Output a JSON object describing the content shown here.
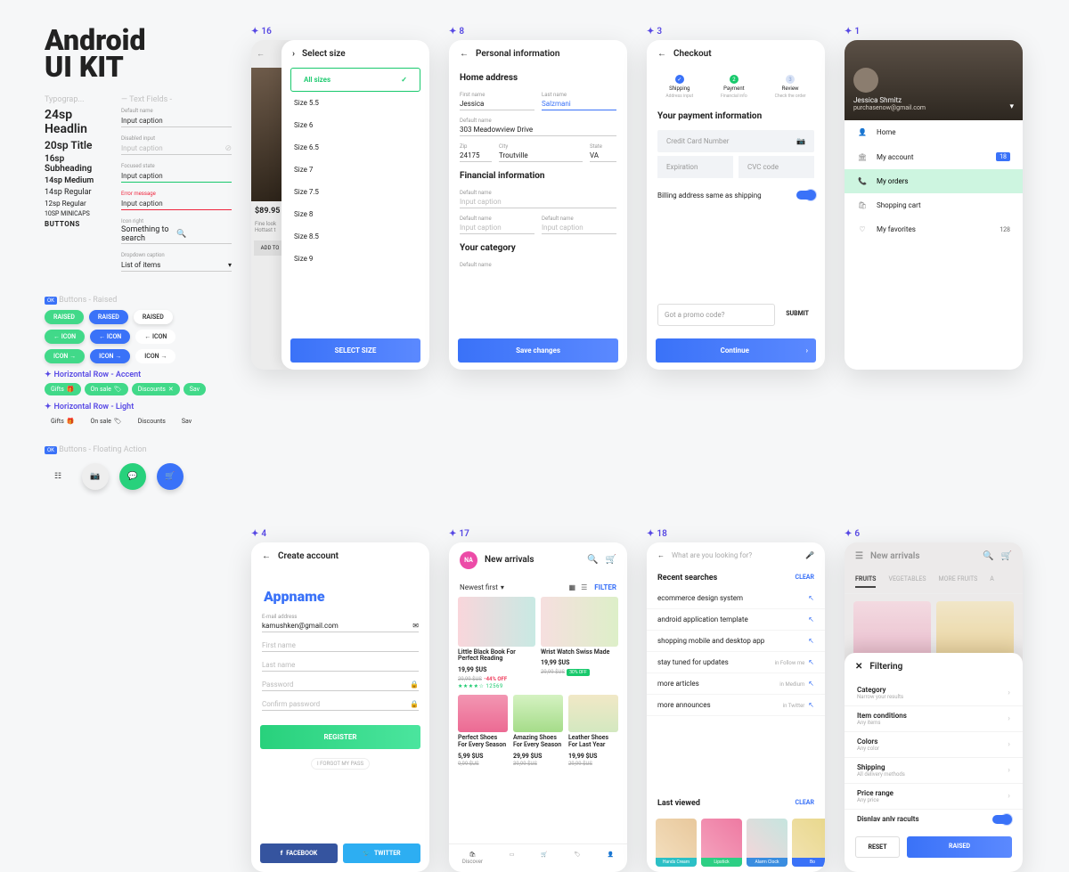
{
  "header": {
    "line1": "Android",
    "line2": "UI KIT"
  },
  "typography": {
    "label": "Typograp...",
    "items": [
      "24sp Headlin",
      "20sp Title",
      "16sp Subheading",
      "14sp Medium",
      "14sp Regular",
      "12sp Regular",
      "10SP MINICAPS",
      "BUTTONS"
    ]
  },
  "textfields": {
    "label": "— Text Fields - ",
    "default_label": "Default name",
    "default": "Input caption",
    "disabled_label": "Disabled input",
    "disabled": "Input caption",
    "focused_label": "Focused state",
    "focused": "Input caption",
    "error_label": "Error message",
    "error": "Input caption",
    "search_label": "Icon right",
    "search": "Something to search",
    "dropdown_label": "Dropdown caption",
    "dropdown": "List of items"
  },
  "buttons_raised": {
    "label": "Buttons - Raised",
    "raised": "RAISED",
    "icon": "ICON"
  },
  "rows": {
    "accent": "Horizontal Row - Accent",
    "light": "Horizontal Row - Light",
    "chips": [
      "Gifts",
      "On sale",
      "Discounts",
      "Sav"
    ]
  },
  "fab": {
    "label": "Buttons - Floating Action"
  },
  "screens": {
    "s16": {
      "tag": "16",
      "title": "Select size",
      "all": "All sizes",
      "sizes": [
        "Size 5.5",
        "Size 6",
        "Size 6.5",
        "Size 7",
        "Size 7.5",
        "Size 8",
        "Size 8.5",
        "Size 9"
      ],
      "price": "$89.95",
      "desc": "Fine look",
      "desc2": "Hottast t",
      "add": "ADD TO",
      "btn": "SELECT SIZE"
    },
    "s8": {
      "tag": "8",
      "title": "Personal information",
      "home": "Home address",
      "first_l": "First name",
      "first": "Jessica",
      "last_l": "Last name",
      "last": "Salzmani",
      "def_l": "Default name",
      "addr": "303 Meadowview Drive",
      "zip_l": "Zip",
      "zip": "24175",
      "city_l": "City",
      "city": "Troutville",
      "state_l": "State",
      "state": "VA",
      "fin": "Financial information",
      "cap": "Input caption",
      "cat": "Your category",
      "btn": "Save changes"
    },
    "s3": {
      "tag": "3",
      "title": "Checkout",
      "steps": [
        {
          "name": "Shipping",
          "sub": "Address input"
        },
        {
          "name": "Payment",
          "sub": "Financial info"
        },
        {
          "name": "Review",
          "sub": "Check the order"
        }
      ],
      "pay": "Your payment information",
      "cc": "Credit Card Number",
      "exp": "Expiration",
      "cvc": "CVC code",
      "billing": "Billing address same as shipping",
      "promo": "Got a promo code?",
      "submit": "SUBMIT",
      "cont": "Continue"
    },
    "s1": {
      "tag": "1",
      "name": "Jessica Shmitz",
      "email": "purchasenow@gmail.com",
      "items": [
        {
          "icon": "person",
          "label": "Home"
        },
        {
          "icon": "account",
          "label": "My account",
          "badge": "18"
        },
        {
          "icon": "phone",
          "label": "My orders",
          "active": true
        },
        {
          "icon": "cart",
          "label": "Shopping cart"
        },
        {
          "icon": "heart",
          "label": "My favorites",
          "count": "128"
        }
      ]
    },
    "s4": {
      "tag": "4",
      "title": "Create account",
      "app": "Appname",
      "email_l": "E-mail address",
      "email": "kamushken@gmail.com",
      "first": "First name",
      "last": "Last name",
      "pass": "Password",
      "confirm": "Confirm password",
      "reg": "REGISTER",
      "forgot": "I FORGOT MY PASS",
      "fb": "FACEBOOK",
      "tw": "TWITTER"
    },
    "s17": {
      "tag": "17",
      "title": "New arrivals",
      "sort": "Newest first",
      "filter": "FILTER",
      "products": [
        {
          "name": "Little Black Book For Perfect Reading",
          "price": "19,99 $US",
          "old": "29,99 $US",
          "disc": "-44% OFF",
          "rating": "★★★★☆ 12569",
          "bg": "linear-gradient(90deg,#f9d6db,#c8e9e3)"
        },
        {
          "name": "Wrist Watch Swiss Made",
          "price": "19,99 $US",
          "old": "29,99 $US",
          "badge": "30% OFF",
          "bg": "linear-gradient(90deg,#f6dfdf,#ddefc8)"
        },
        {
          "name": "Perfect Shoes For Every Season",
          "price": "5,99 $US",
          "old": "9,99 $US",
          "bg": "linear-gradient(180deg,#F296B2,#ec6a93)"
        },
        {
          "name": "Amazing Shoes For Every Season",
          "price": "29,99 $US",
          "old": "39,99 $US",
          "bg": "linear-gradient(180deg,#d5f2c2,#a5dc89)"
        },
        {
          "name": "Leather Shoes For Last Year",
          "price": "19,99 $US",
          "old": "29,99 $US",
          "bg": "linear-gradient(180deg,#f1e8c6,#d3e8c0)"
        }
      ],
      "botnav": [
        "Discover",
        "",
        "",
        "",
        ""
      ]
    },
    "s18": {
      "tag": "18",
      "placeholder": "What are you looking for?",
      "recent": "Recent searches",
      "clear": "CLEAR",
      "items": [
        {
          "q": "ecommerce design system"
        },
        {
          "q": "android application template"
        },
        {
          "q": "shopping mobile and desktop app"
        },
        {
          "q": "stay tuned for updates",
          "src": "in Follow me"
        },
        {
          "q": "more articles",
          "src": "in Medium"
        },
        {
          "q": "more announces",
          "src": "in Twitter"
        }
      ],
      "lv": "Last viewed",
      "lv_items": [
        {
          "label": "Hands Cream",
          "c": "#2cc0c6"
        },
        {
          "label": "Lipstick",
          "c": "#2dcf84"
        },
        {
          "label": "Alarm Clock",
          "c": "#3a8de0"
        },
        {
          "label": "Bo",
          "c": "#3a72f8"
        }
      ]
    },
    "s6": {
      "tag": "6",
      "title": "New arrivals",
      "tabs": [
        "FRUITS",
        "VEGETABLES",
        "MORE FRUITS",
        "A"
      ],
      "filter_title": "Filtering",
      "filters": [
        {
          "t": "Category",
          "s": "Narrow your results"
        },
        {
          "t": "Item conditions",
          "s": "Any items"
        },
        {
          "t": "Colors",
          "s": "Any color"
        },
        {
          "t": "Shipping",
          "s": "All delivery methods"
        },
        {
          "t": "Price range",
          "s": "Any price"
        }
      ],
      "toggle": "Disnlav anlv racults",
      "reset": "RESET",
      "raised": "RAISED"
    }
  }
}
